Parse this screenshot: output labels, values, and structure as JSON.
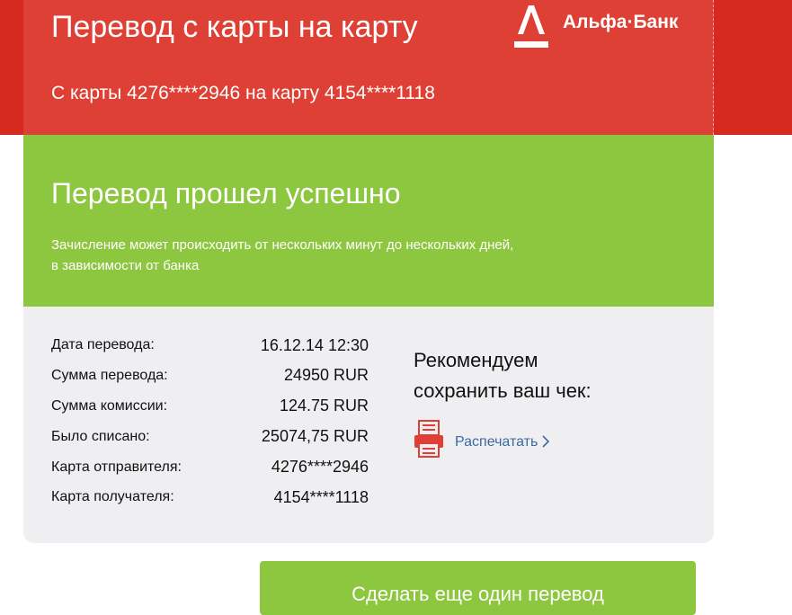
{
  "header": {
    "title": "Перевод с карты на карту",
    "subtitle": "С карты 4276****2946 на карту 4154****1118",
    "bank_logo_text": "Альфа·Банк",
    "bank_logo_icon": "alfa-bank-icon"
  },
  "status": {
    "title": "Перевод прошел успешно",
    "note_line1": "Зачисление может происходить от нескольких минут до нескольких дней,",
    "note_line2": "в зависимости от банка"
  },
  "details": {
    "rows": [
      {
        "label": "Дата перевода:",
        "value": "16.12.14 12:30"
      },
      {
        "label": "Сумма перевода:",
        "value": "24950 RUR"
      },
      {
        "label": "Сумма комиссии:",
        "value": "124.75 RUR"
      },
      {
        "label": "Было списано:",
        "value": "25074,75 RUR"
      },
      {
        "label": "Карта отправителя:",
        "value": "4276****2946"
      },
      {
        "label": "Карта получателя:",
        "value": "4154****1118"
      }
    ]
  },
  "receipt": {
    "recommend_line1": "Рекомендуем",
    "recommend_line2": "сохранить ваш чек:",
    "print_label": "Распечатать",
    "print_icon": "printer-icon"
  },
  "actions": {
    "another_transfer_label": "Сделать еще один перевод"
  },
  "colors": {
    "red": "#df4035",
    "green": "#8dc63f",
    "gray_panel": "#efeff2",
    "link_blue": "#3c6aa0"
  }
}
